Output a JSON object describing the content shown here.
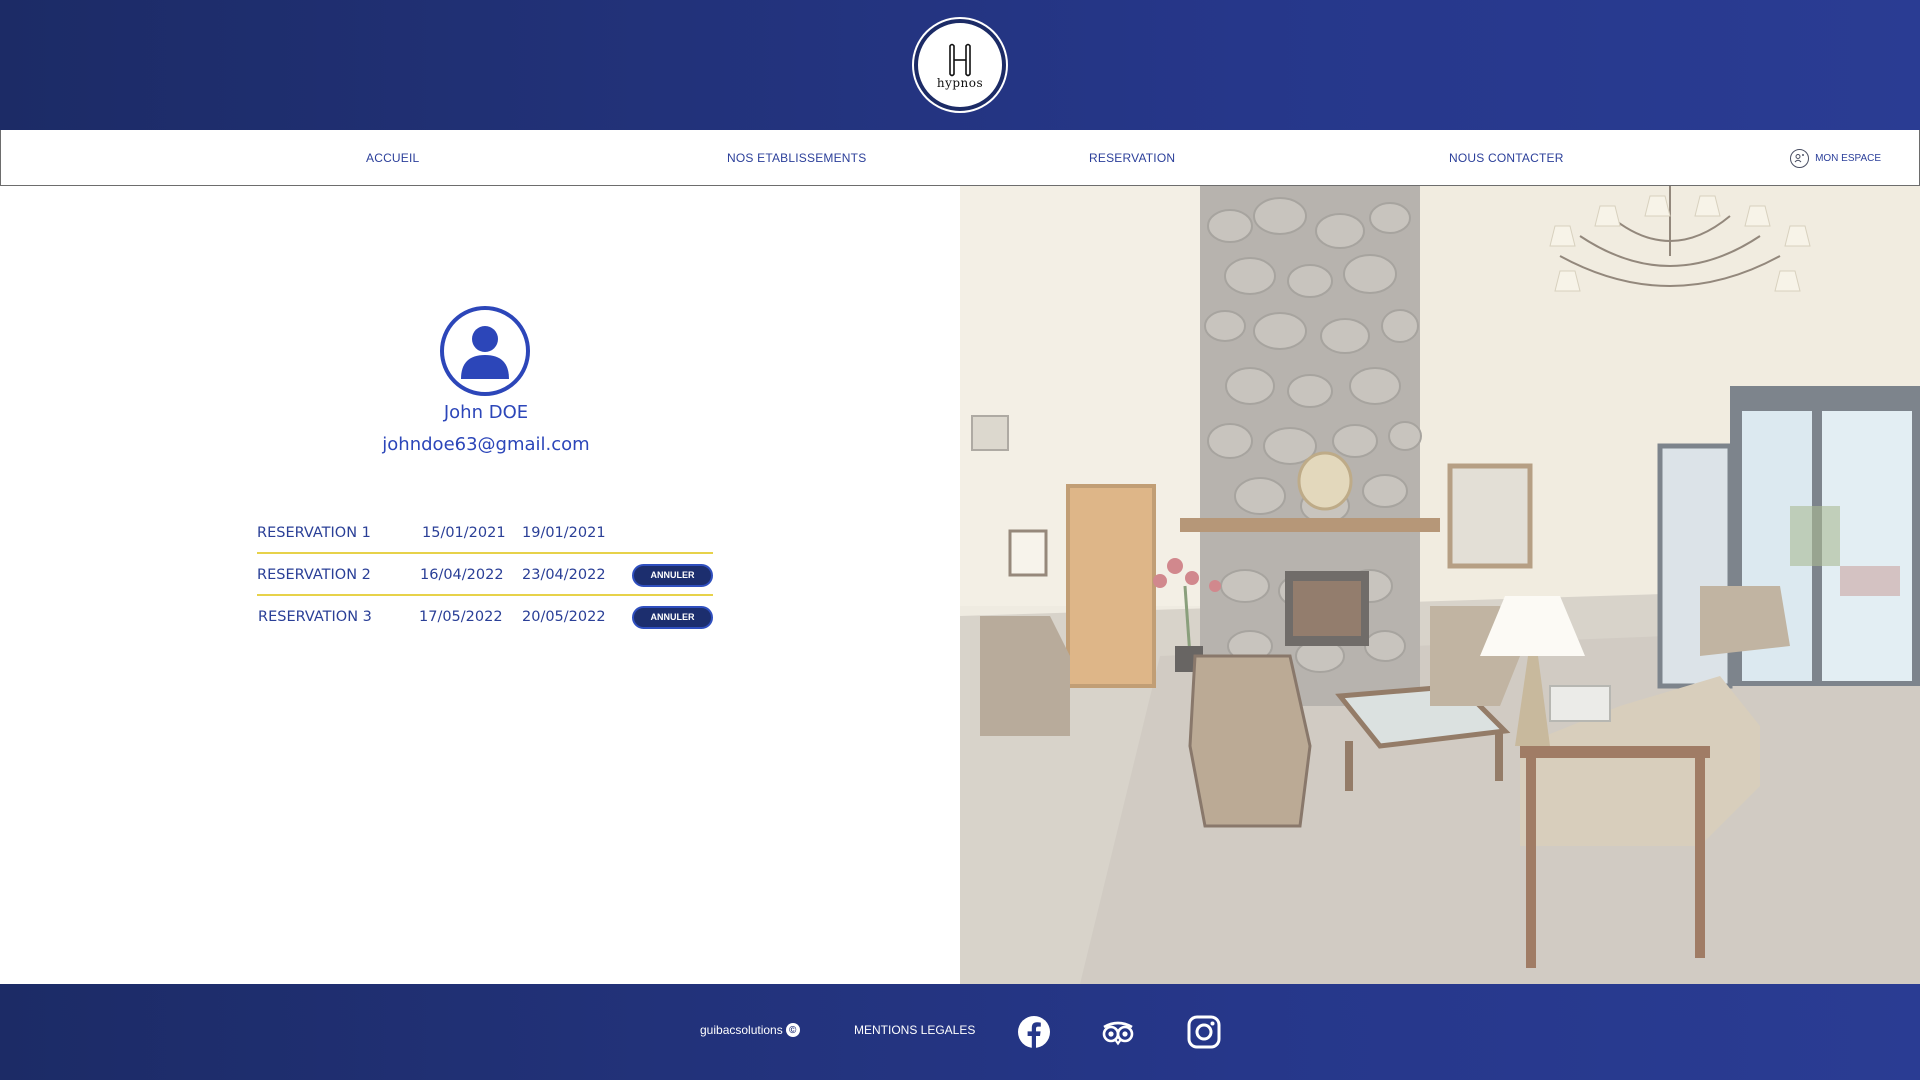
{
  "header": {
    "logo": {
      "letter": "H",
      "text": "hypnos"
    }
  },
  "nav": {
    "items": [
      {
        "label": "ACCUEIL"
      },
      {
        "label": "NOS ETABLISSEMENTS"
      },
      {
        "label": "RESERVATION"
      },
      {
        "label": "NOUS CONTACTER"
      }
    ],
    "account": {
      "label": "MON ESPACE",
      "icon": "account-icon"
    }
  },
  "profile": {
    "name": "John DOE",
    "email": "johndoe63@gmail.com",
    "avatar_icon": "user-avatar-icon"
  },
  "reservations": [
    {
      "name": "RESERVATION 1",
      "start": "15/01/2021",
      "end": "19/01/2021",
      "action": null
    },
    {
      "name": "RESERVATION 2",
      "start": "16/04/2022",
      "end": "23/04/2022",
      "action": "ANNULER"
    },
    {
      "name": "RESERVATION 3",
      "start": "17/05/2022",
      "end": "20/05/2022",
      "action": "ANNULER"
    }
  ],
  "footer": {
    "brand": "guibacsolutions",
    "copyright_symbol": "©",
    "legal": "MENTIONS LEGALES",
    "social": [
      "facebook-icon",
      "tripadvisor-icon",
      "instagram-icon"
    ]
  },
  "colors": {
    "primary_dark": "#1c2b66",
    "primary": "#2c46b9",
    "accent_line": "#e7d24a",
    "button": "#1c2e6e"
  }
}
